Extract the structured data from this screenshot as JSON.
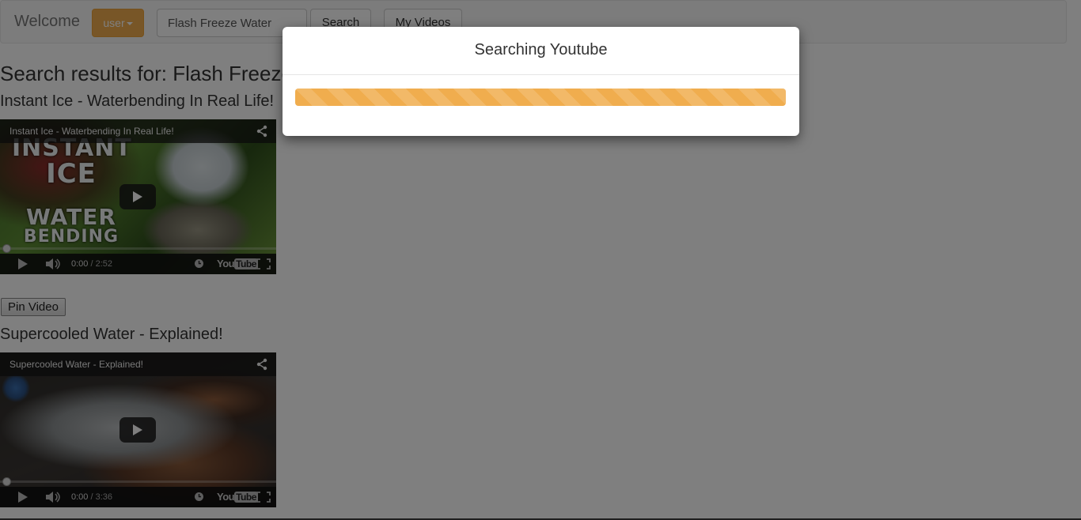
{
  "navbar": {
    "brand": "Welcome",
    "user_label": "user",
    "search_value": "Flash Freeze Water",
    "search_button": "Search",
    "my_videos_button": "My Videos"
  },
  "results": {
    "heading": "Search results for: Flash Freeze Water",
    "pin_button": "Pin Video",
    "videos": [
      {
        "title": "Instant Ice - Waterbending In Real Life!",
        "player_title": "Instant Ice - Waterbending In Real Life!",
        "current_time": "0:00",
        "duration": "/ 2:52",
        "thumbnail_text": [
          "INSTANT",
          "ICE",
          "WATER",
          "BENDING"
        ]
      },
      {
        "title": "Supercooled Water - Explained!",
        "player_title": "Supercooled Water - Explained!",
        "current_time": "0:00",
        "duration": "/ 3:36"
      }
    ]
  },
  "modal": {
    "title": "Searching Youtube",
    "progress": 1.0,
    "bar_color": "#f0ad4e"
  },
  "colors": {
    "accent": "#f0ad4e",
    "navbar_bg": "#f8f8f8",
    "backdrop": "rgba(0,0,0,0.5)"
  },
  "youtube_logo": {
    "you": "You",
    "tube": "Tube"
  }
}
